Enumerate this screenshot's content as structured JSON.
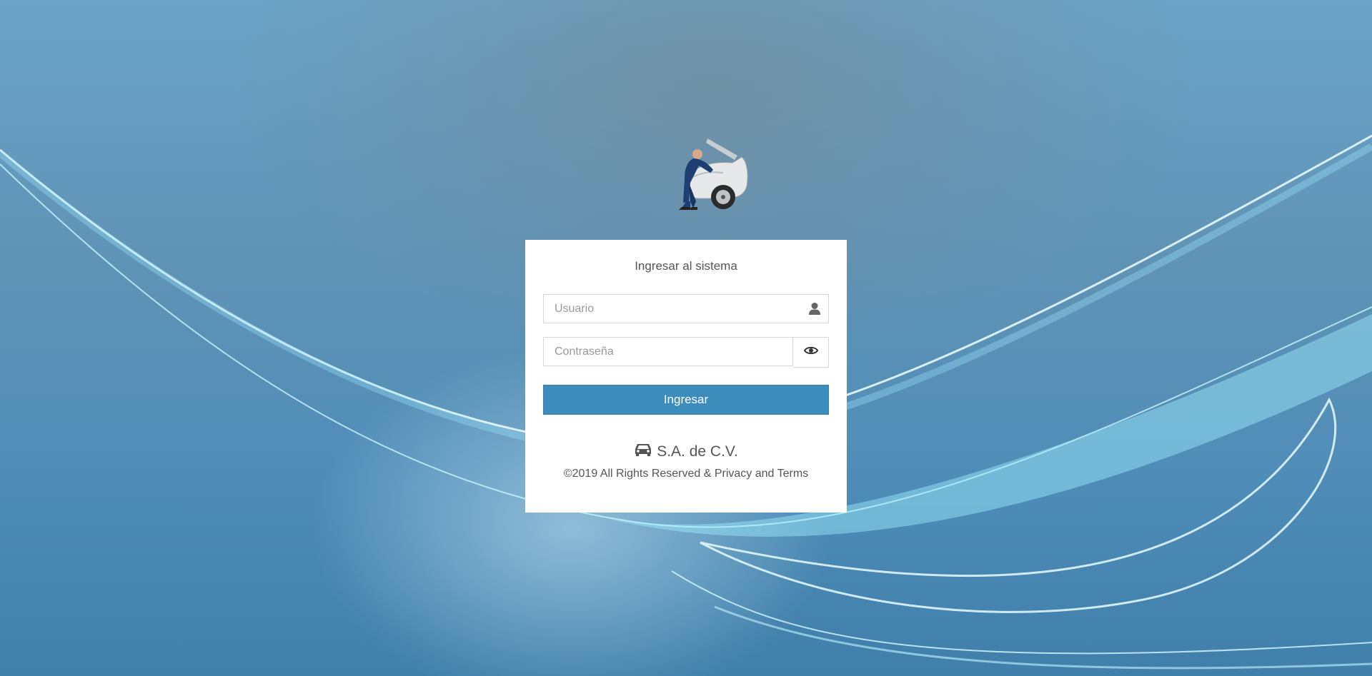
{
  "login": {
    "title": "Ingresar al sistema",
    "username_placeholder": "Usuario",
    "password_placeholder": "Contraseña",
    "submit_label": "Ingresar"
  },
  "footer": {
    "company": "S.A. de C.V.",
    "copyright": "©2019 All Rights Reserved & Privacy and Terms"
  },
  "icons": {
    "username": "user-icon",
    "password_toggle": "eye-icon",
    "company": "car-icon",
    "logo": "mechanic-car-logo"
  },
  "colors": {
    "primary": "#3c8dbc",
    "panel": "#ffffff",
    "text": "#555555"
  }
}
